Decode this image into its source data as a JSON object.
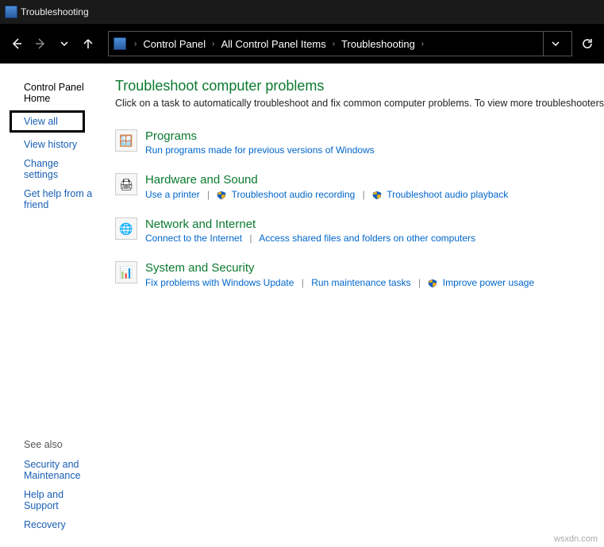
{
  "window": {
    "title": "Troubleshooting"
  },
  "breadcrumb": {
    "root": "Control Panel",
    "mid": "All Control Panel Items",
    "leaf": "Troubleshooting"
  },
  "sidebar": {
    "home": "Control Panel Home",
    "viewall": "View all",
    "viewhistory": "View history",
    "changesettings": "Change settings",
    "gethelp": "Get help from a friend",
    "seealso_hdr": "See also",
    "secmaint": "Security and Maintenance",
    "helpsupport": "Help and Support",
    "recovery": "Recovery"
  },
  "main": {
    "title": "Troubleshoot computer problems",
    "desc": "Click on a task to automatically troubleshoot and fix common computer problems. To view more troubleshooters"
  },
  "cats": {
    "programs": {
      "title": "Programs",
      "l1": "Run programs made for previous versions of Windows"
    },
    "hw": {
      "title": "Hardware and Sound",
      "l1": "Use a printer",
      "l2": "Troubleshoot audio recording",
      "l3": "Troubleshoot audio playback"
    },
    "net": {
      "title": "Network and Internet",
      "l1": "Connect to the Internet",
      "l2": "Access shared files and folders on other computers"
    },
    "sys": {
      "title": "System and Security",
      "l1": "Fix problems with Windows Update",
      "l2": "Run maintenance tasks",
      "l3": "Improve power usage"
    }
  },
  "watermark": "wsxdn.com"
}
